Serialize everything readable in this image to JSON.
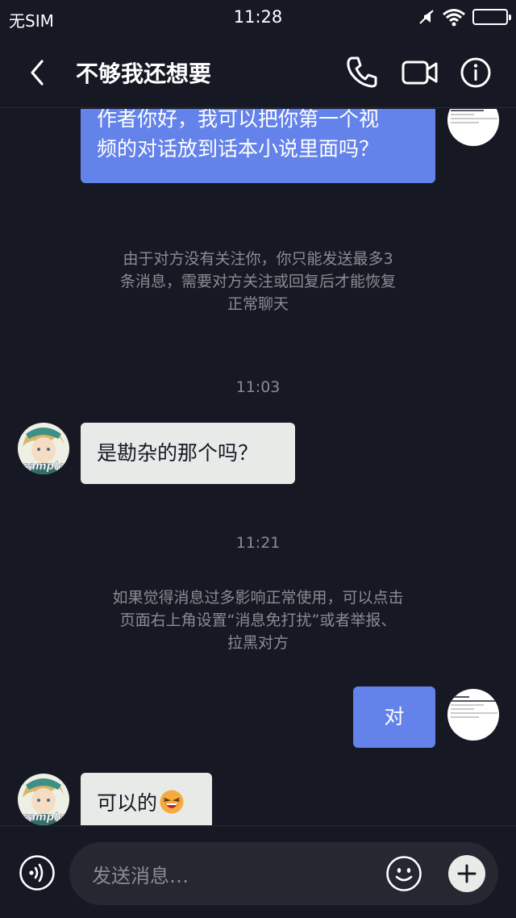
{
  "status_bar": {
    "carrier": "无SIM",
    "time": "11:28",
    "icons": [
      "mute-icon",
      "wifi-icon",
      "battery-icon"
    ]
  },
  "nav": {
    "title": "不够我还想要",
    "icons": [
      "back-icon",
      "phone-icon",
      "video-icon",
      "info-icon"
    ]
  },
  "messages": {
    "out_1": {
      "text_line1": "作者你好，我可以把你第一个视",
      "text_line2": "频的对话放到话本小说里面吗？"
    },
    "system_1": {
      "line1": "由于对方没有关注你，你只能发送最多3",
      "line2": "条消息，需要对方关注或回复后才能恢复",
      "line3": "正常聊天"
    },
    "time_1": "11:03",
    "in_1": {
      "text": "是勘杂的那个吗？",
      "avatar_watermark": "sample"
    },
    "time_2": "11:21",
    "system_2": {
      "line1": "如果觉得消息过多影响正常使用，可以点击",
      "line2": "页面右上角设置“消息免打扰”或者举报、",
      "line3": "拉黑对方"
    },
    "out_2": {
      "text": "对"
    },
    "in_2": {
      "text": "可以的",
      "emoji": "laughing-face-emoji",
      "avatar_watermark": "sample"
    }
  },
  "input_bar": {
    "placeholder": "发送消息…",
    "icons": [
      "voice-icon",
      "emoji-icon",
      "plus-icon"
    ]
  },
  "colors": {
    "background": "#161823",
    "outgoing_bubble": "#6483ea",
    "incoming_bubble": "#e8eae8",
    "system_text": "#8a8c92"
  }
}
